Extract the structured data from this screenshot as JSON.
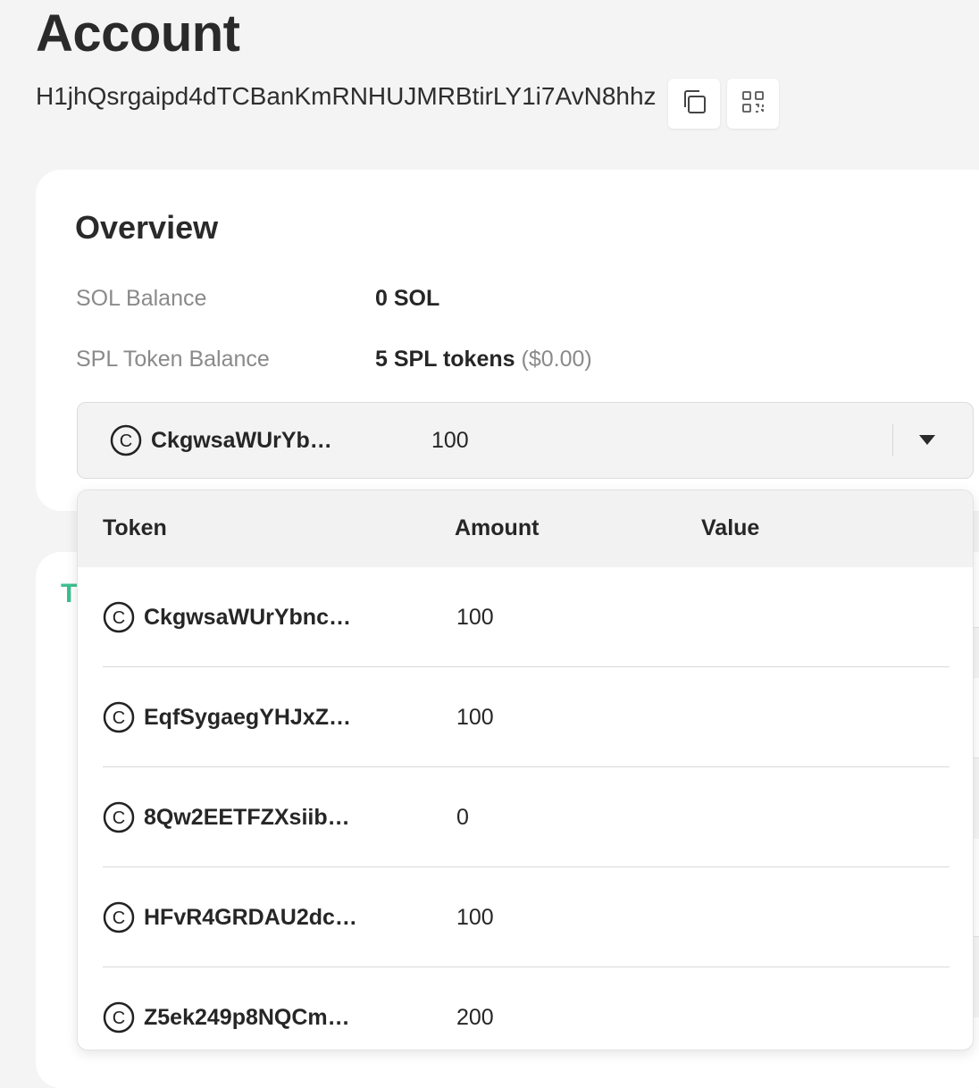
{
  "page": {
    "title": "Account",
    "address": "H1jhQsrgaipd4dTCBanKmRNHUJMRBtirLY1i7AvN8hhz",
    "copy_icon": "copy-icon",
    "qr_icon": "qr-code-icon"
  },
  "overview": {
    "title": "Overview",
    "sol_balance_label": "SOL Balance",
    "sol_balance_value": "0 SOL",
    "spl_balance_label": "SPL Token Balance",
    "spl_balance_value": "5 SPL tokens",
    "spl_balance_usd": "($0.00)"
  },
  "token_select": {
    "selected_name": "CkgwsaWUrYb…",
    "selected_amount": "100",
    "coin_icon": "coin-icon",
    "caret_icon": "caret-down-icon"
  },
  "second_card": {
    "peek_text": "T"
  },
  "dropdown": {
    "columns": [
      "Token",
      "Amount",
      "Value"
    ],
    "rows": [
      {
        "name": "CkgwsaWUrYbnc…",
        "amount": "100",
        "value": ""
      },
      {
        "name": "EqfSygaegYHJxZ…",
        "amount": "100",
        "value": ""
      },
      {
        "name": "8Qw2EETFZXsiib…",
        "amount": "0",
        "value": ""
      },
      {
        "name": "HFvR4GRDAU2dc…",
        "amount": "100",
        "value": ""
      },
      {
        "name": "Z5ek249p8NQCm…",
        "amount": "200",
        "value": ""
      }
    ]
  },
  "colors": {
    "background": "#f4f4f4",
    "card": "#ffffff",
    "accent_green": "#3dbf8f",
    "muted_text": "#8a8a8a"
  }
}
